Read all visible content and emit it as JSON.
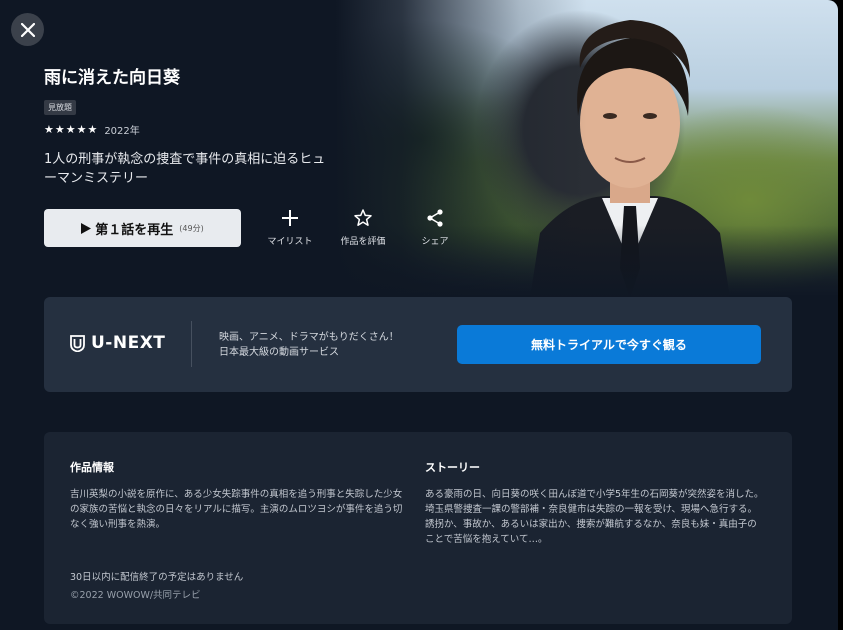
{
  "title": "雨に消えた向日葵",
  "badge": "見放題",
  "rating": {
    "stars": 4.5,
    "stars_display": "★★★★★",
    "year": "2022年"
  },
  "catchphrase": "1人の刑事が執念の捜査で事件の真相に迫るヒューマンミステリー",
  "play": {
    "label": "第１話を再生",
    "duration": "(49分)"
  },
  "actions": [
    {
      "label": "マイリスト",
      "icon": "plus-icon"
    },
    {
      "label": "作品を評価",
      "icon": "star-outline-icon"
    },
    {
      "label": "シェア",
      "icon": "share-icon"
    }
  ],
  "banner": {
    "logo": "U-NEXT",
    "line1": "映画、アニメ、ドラマがもりだくさん！",
    "line2": "日本最大級の動画サービス",
    "cta": "無料トライアルで今すぐ観る"
  },
  "info": {
    "work_heading": "作品情報",
    "work_text": "吉川英梨の小説を原作に、ある少女失踪事件の真相を追う刑事と失踪した少女の家族の苦悩と執念の日々をリアルに描写。主演のムロツヨシが事件を追う切なく強い刑事を熱演。",
    "story_heading": "ストーリー",
    "story_text": "ある豪雨の日、向日葵の咲く田んぼ道で小学5年生の石岡葵が突然姿を消した。埼玉県警捜査一課の警部補・奈良健市は失踪の一報を受け、現場へ急行する。誘拐か、事故か、あるいは家出か、捜索が難航するなか、奈良も妹・真由子のことで苦悩を抱えていて…。",
    "notice": "30日以内に配信終了の予定はありません",
    "copyright": "©2022 WOWOW/共同テレビ"
  },
  "colors": {
    "accent": "#0a7ad8",
    "background": "#0f1724"
  }
}
